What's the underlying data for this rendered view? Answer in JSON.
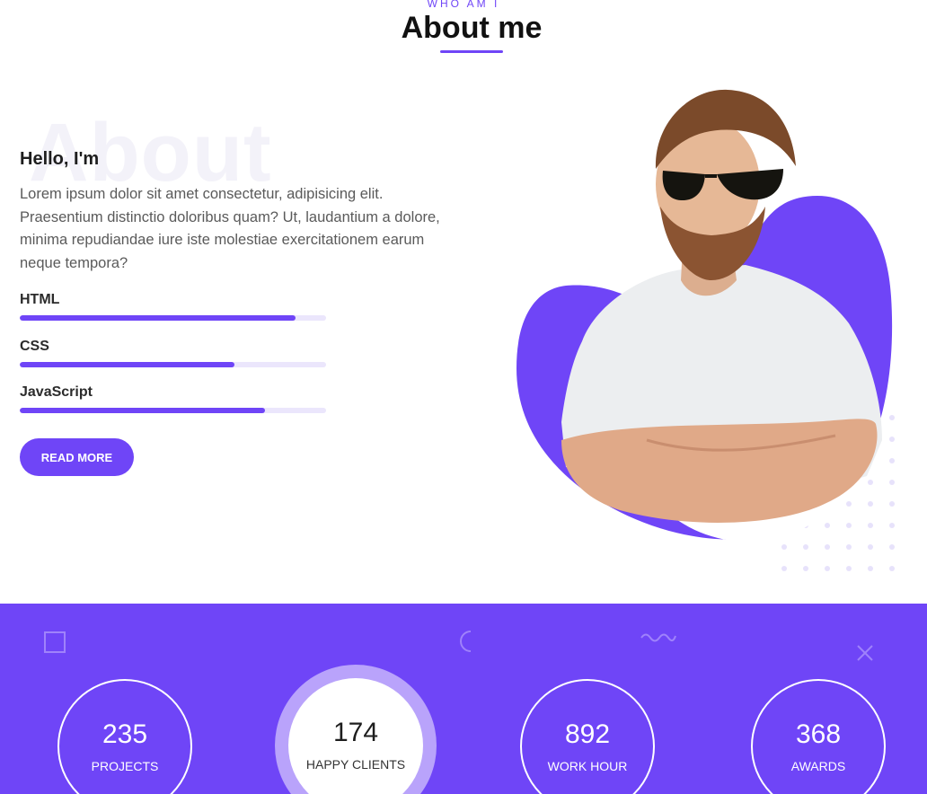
{
  "section": {
    "eyebrow": "WHO AM I",
    "title": "About me"
  },
  "about": {
    "ghost_text": "About",
    "greeting": "Hello, I'm",
    "paragraph": "Lorem ipsum dolor sit amet consectetur, adipisicing elit. Praesentium distinctio doloribus quam? Ut, laudantium a dolore, minima repudiandae iure iste molestiae exercitationem earum neque tempora?",
    "skills": [
      {
        "label": "HTML",
        "level": 0.9
      },
      {
        "label": "CSS",
        "level": 0.7
      },
      {
        "label": "JavaScript",
        "level": 0.8
      }
    ],
    "button_label": "READ MORE"
  },
  "stats": [
    {
      "value": "235",
      "label": "PROJECTS"
    },
    {
      "value": "174",
      "label": "HAPPY CLIENTS"
    },
    {
      "value": "892",
      "label": "WORK HOUR"
    },
    {
      "value": "368",
      "label": "AWARDS"
    }
  ],
  "colors": {
    "accent": "#6f45f7",
    "track": "#ebe6fc"
  },
  "icons": [
    "square-outline-icon",
    "crescent-icon",
    "wave-icon",
    "cross-icon"
  ]
}
